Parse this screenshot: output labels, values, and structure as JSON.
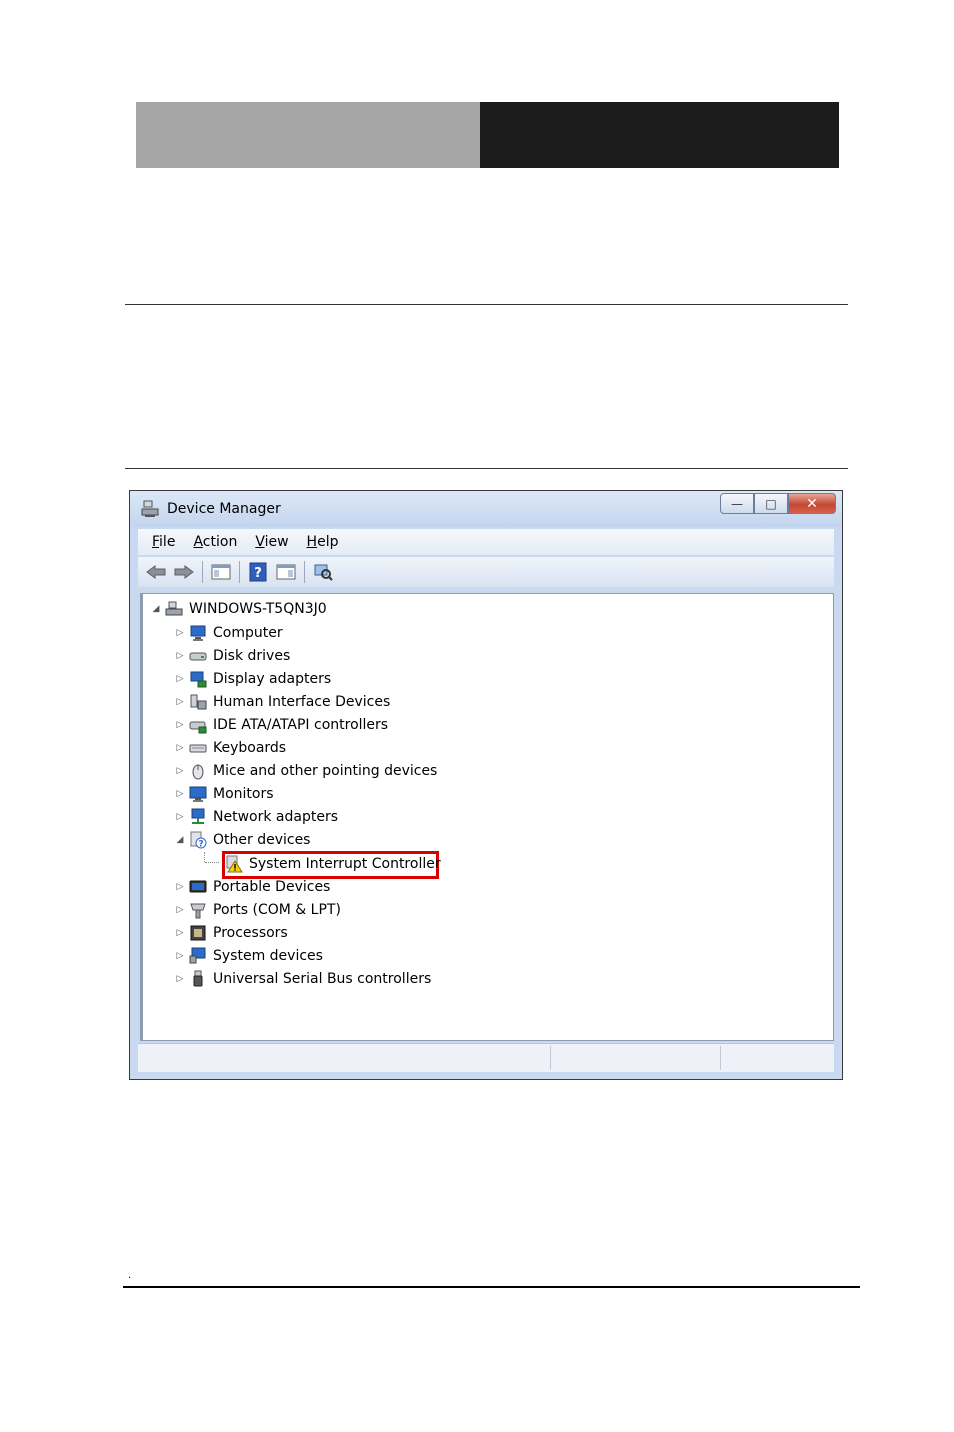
{
  "window": {
    "title": "Device Manager",
    "controls": [
      "minimize",
      "maximize",
      "close"
    ]
  },
  "menubar": [
    {
      "label": "File",
      "accel": "F",
      "rest": "ile"
    },
    {
      "label": "Action",
      "accel": "A",
      "rest": "ction"
    },
    {
      "label": "View",
      "accel": "V",
      "rest": "iew"
    },
    {
      "label": "Help",
      "accel": "H",
      "rest": "elp"
    }
  ],
  "toolbar": [
    "back-icon",
    "forward-icon",
    "show-hide-tree-icon",
    "help-icon",
    "properties-icon",
    "scan-hardware-icon"
  ],
  "tree": {
    "root": "WINDOWS-T5QN3J0",
    "items": [
      {
        "label": "Computer",
        "icon": "computer-icon",
        "expanded": false
      },
      {
        "label": "Disk drives",
        "icon": "disk-drive-icon",
        "expanded": false
      },
      {
        "label": "Display adapters",
        "icon": "display-adapter-icon",
        "expanded": false
      },
      {
        "label": "Human Interface Devices",
        "icon": "hid-icon",
        "expanded": false
      },
      {
        "label": "IDE ATA/ATAPI controllers",
        "icon": "ide-controller-icon",
        "expanded": false
      },
      {
        "label": "Keyboards",
        "icon": "keyboard-icon",
        "expanded": false
      },
      {
        "label": "Mice and other pointing devices",
        "icon": "mouse-icon",
        "expanded": false
      },
      {
        "label": "Monitors",
        "icon": "monitor-icon",
        "expanded": false
      },
      {
        "label": "Network adapters",
        "icon": "network-adapter-icon",
        "expanded": false
      },
      {
        "label": "Other devices",
        "icon": "unknown-device-icon",
        "expanded": true
      },
      {
        "label": "Portable Devices",
        "icon": "portable-device-icon",
        "expanded": false
      },
      {
        "label": "Ports (COM & LPT)",
        "icon": "port-icon",
        "expanded": false
      },
      {
        "label": "Processors",
        "icon": "processor-icon",
        "expanded": false
      },
      {
        "label": "System devices",
        "icon": "system-device-icon",
        "expanded": false
      },
      {
        "label": "Universal Serial Bus controllers",
        "icon": "usb-icon",
        "expanded": false
      }
    ],
    "other_devices_child": {
      "label": "System Interrupt Controller",
      "icon": "warning-icon"
    }
  },
  "colors": {
    "highlight_border": "#d90000",
    "header_left": "#a5a5a5",
    "header_right": "#1c1c1c"
  }
}
